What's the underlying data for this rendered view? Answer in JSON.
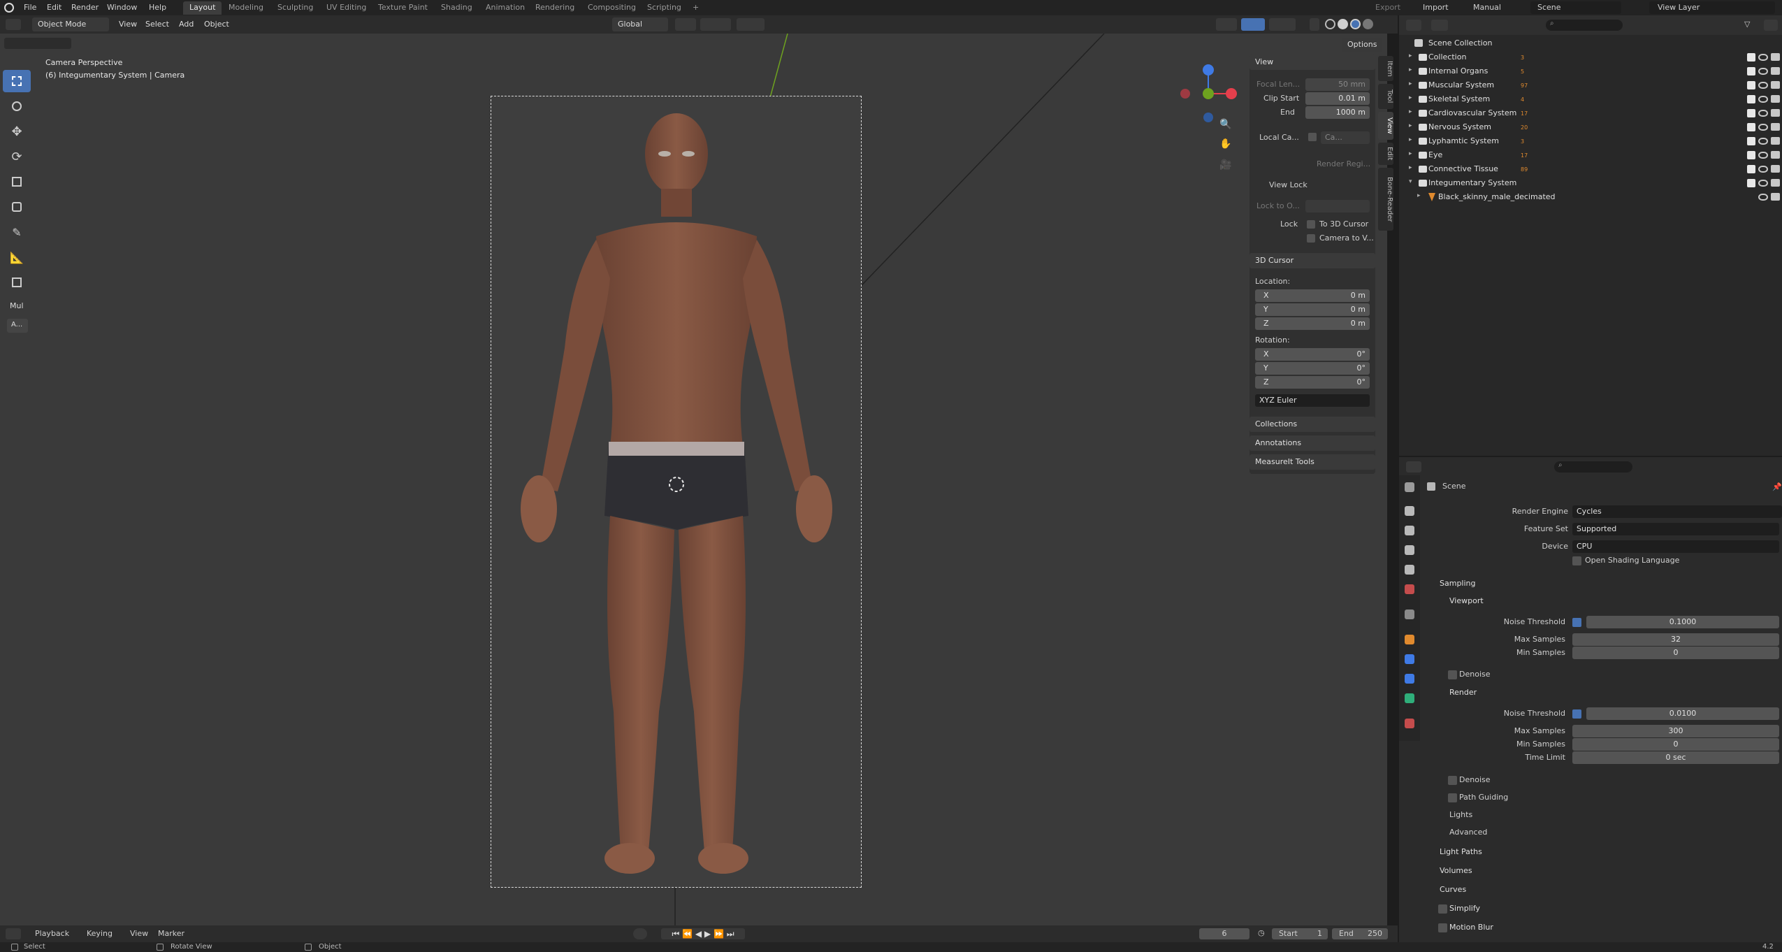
{
  "topbar": {
    "menus": [
      "File",
      "Edit",
      "Render",
      "Window",
      "Help"
    ],
    "workspaces": [
      "Layout",
      "Modeling",
      "Sculpting",
      "UV Editing",
      "Texture Paint",
      "Shading",
      "Animation",
      "Rendering",
      "Compositing",
      "Scripting"
    ],
    "add_tab": "+",
    "export": "Export",
    "import": "Import",
    "manual": "Manual",
    "scene": "Scene",
    "view_layer": "View Layer"
  },
  "viewport_header": {
    "mode": "Object Mode",
    "menus": [
      "View",
      "Select",
      "Add",
      "Object"
    ],
    "orientation": "Global",
    "options": "Options"
  },
  "viewport": {
    "camera_label": "Camera Perspective",
    "object_label": "(6) Integumentary System | Camera",
    "tool_section_label": "Mul",
    "tool_section_button": "A..."
  },
  "npanel": {
    "tabs": [
      "Item",
      "Tool",
      "View",
      "Edit",
      "Bone-Reader"
    ],
    "view_section": "View",
    "focal_length_label": "Focal Len...",
    "focal_length_value": "50 mm",
    "clip_start_label": "Clip Start",
    "clip_start_value": "0.01 m",
    "clip_end_label": "End",
    "clip_end_value": "1000 m",
    "local_camera_label": "Local Ca...",
    "local_camera_value": "Ca...",
    "render_region_label": "Render Regi...",
    "view_lock_section": "View Lock",
    "lock_to_object_label": "Lock to O...",
    "lock_label": "Lock",
    "to_3d_cursor": "To 3D Cursor",
    "camera_to_view": "Camera to V...",
    "cursor_section": "3D Cursor",
    "location_label": "Location:",
    "loc_x": "0 m",
    "loc_y": "0 m",
    "loc_z": "0 m",
    "rotation_label": "Rotation:",
    "rot_x": "0°",
    "rot_y": "0°",
    "rot_z": "0°",
    "rotation_mode": "XYZ Euler",
    "axis_x": "X",
    "axis_y": "Y",
    "axis_z": "Z",
    "collections_section": "Collections",
    "annotations_section": "Annotations",
    "measureit_section": "MeasureIt Tools"
  },
  "outliner": {
    "root": "Scene Collection",
    "items": [
      {
        "label": "Collection",
        "badge": "3"
      },
      {
        "label": "Internal Organs",
        "badge": "5"
      },
      {
        "label": "Muscular System",
        "badge": "97"
      },
      {
        "label": "Skeletal System",
        "badge": "4"
      },
      {
        "label": "Cardiovascular System",
        "badge": "17"
      },
      {
        "label": "Nervous System",
        "badge": "20"
      },
      {
        "label": "Lyphamtic System",
        "badge": "3"
      },
      {
        "label": "Eye",
        "badge": "17"
      },
      {
        "label": "Connective Tissue",
        "badge": "89"
      },
      {
        "label": "Integumentary System",
        "badge": ""
      },
      {
        "label": "Black_skinny_male_decimated",
        "badge": ""
      }
    ]
  },
  "properties": {
    "context": "Scene",
    "render_engine_label": "Render Engine",
    "render_engine": "Cycles",
    "feature_set_label": "Feature Set",
    "feature_set": "Supported",
    "device_label": "Device",
    "device": "CPU",
    "osl_label": "Open Shading Language",
    "sampling": "Sampling",
    "viewport": "Viewport",
    "noise_threshold_label": "Noise Threshold",
    "vp_noise_threshold": "0.1000",
    "max_samples_label": "Max Samples",
    "vp_max_samples": "32",
    "min_samples_label": "Min Samples",
    "vp_min_samples": "0",
    "denoise": "Denoise",
    "render": "Render",
    "r_noise_threshold": "0.0100",
    "r_max_samples": "300",
    "r_min_samples": "0",
    "time_limit_label": "Time Limit",
    "r_time_limit": "0 sec",
    "denoise2": "Denoise",
    "path_guiding": "Path Guiding",
    "lights": "Lights",
    "advanced": "Advanced",
    "light_paths": "Light Paths",
    "volumes": "Volumes",
    "curves": "Curves",
    "simplify": "Simplify",
    "motion_blur": "Motion Blur"
  },
  "timeline": {
    "menus": [
      "Playback",
      "Keying",
      "View",
      "Marker"
    ],
    "current_frame": "6",
    "start_label": "Start",
    "start": "1",
    "end_label": "End",
    "end": "250"
  },
  "status": {
    "select": "Select",
    "rotate_view": "Rotate View",
    "object": "Object",
    "version": "4.2"
  },
  "colors": {
    "accent": "#4772b3",
    "orange": "#e08a2e",
    "gizmo_x": "#e53f4c",
    "gizmo_y": "#6ea21f",
    "gizmo_z": "#3f7ae5"
  }
}
